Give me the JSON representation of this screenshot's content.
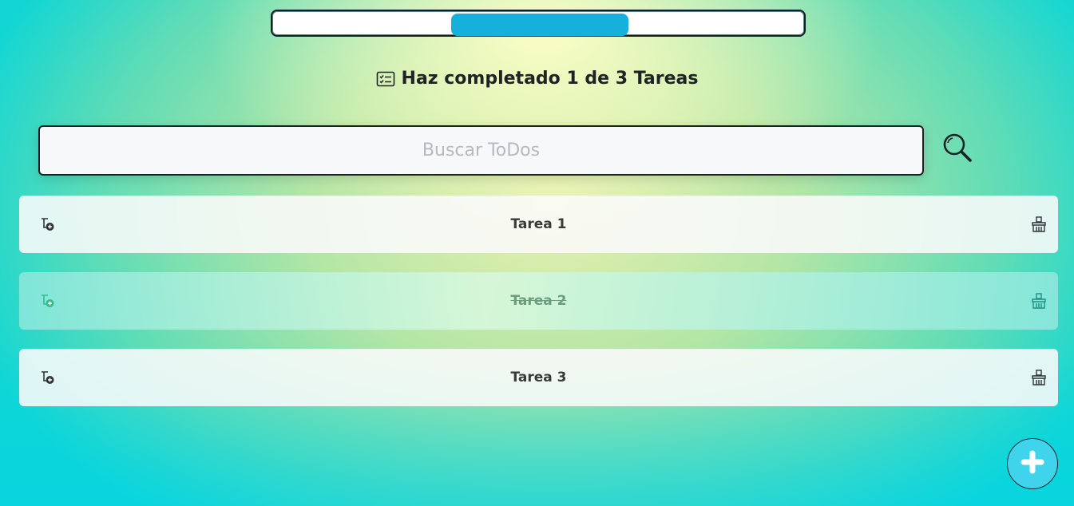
{
  "progress": {
    "completed_fraction": 0.333
  },
  "counter": {
    "icon": "task-list-icon",
    "text": "Haz completado 1 de 3 Tareas"
  },
  "search": {
    "placeholder": "Buscar ToDos",
    "value": "",
    "button_icon": "search-icon"
  },
  "todos": [
    {
      "text": "Tarea 1",
      "completed": false,
      "check_icon": "add-task-icon",
      "delete_icon": "broom-icon"
    },
    {
      "text": "Tarea 2",
      "completed": true,
      "check_icon": "add-task-icon",
      "delete_icon": "broom-icon"
    },
    {
      "text": "Tarea 3",
      "completed": false,
      "check_icon": "add-task-icon",
      "delete_icon": "broom-icon"
    }
  ],
  "add_button": {
    "icon": "plus-icon"
  },
  "colors": {
    "progress_fill": "#16b0dc",
    "accent_completed": "#2fbf8a",
    "add_button_bg": "#40d4ec"
  }
}
